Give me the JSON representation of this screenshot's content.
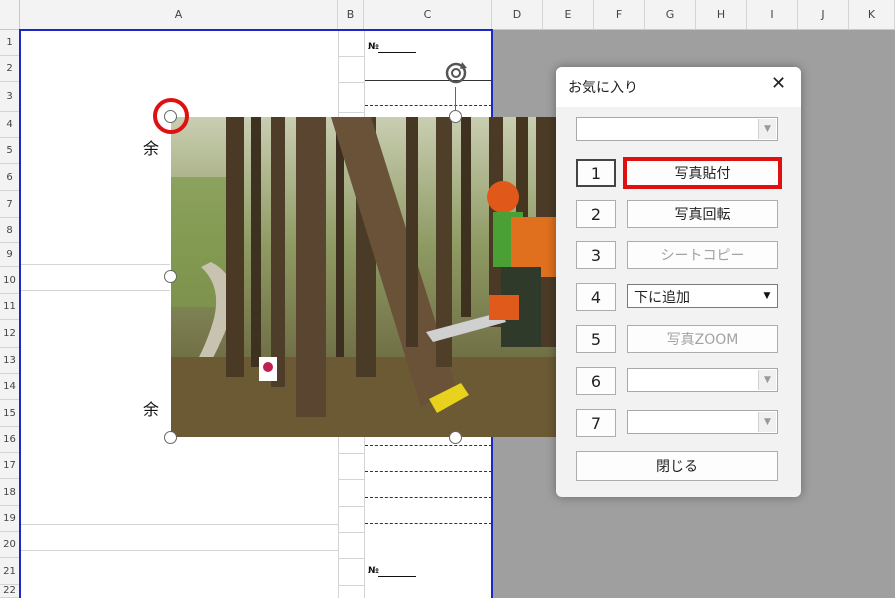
{
  "spreadsheet": {
    "columns": [
      "A",
      "B",
      "C",
      "D",
      "E",
      "F",
      "G",
      "H",
      "I",
      "J",
      "K"
    ],
    "rows": [
      "1",
      "2",
      "3",
      "4",
      "5",
      "6",
      "7",
      "8",
      "9",
      "10",
      "11",
      "12",
      "13",
      "14",
      "15",
      "16",
      "17",
      "18",
      "19",
      "20",
      "21",
      "22"
    ],
    "cell_mark_top": "№",
    "cell_mark_bottom": "№",
    "cell_text_1": "余",
    "cell_text_2": "余"
  },
  "dialog": {
    "title": "お気に入り",
    "close_glyph": "✕",
    "combo_top_value": "",
    "buttons": {
      "num1": "1",
      "num2": "2",
      "num3": "3",
      "num4": "4",
      "num5": "5",
      "num6": "6",
      "num7": "7",
      "paste_photo": "写真貼付",
      "rotate_photo": "写真回転",
      "sheet_copy": "シートコピー",
      "add_below": "下に追加",
      "photo_zoom": "写真ZOOM",
      "close": "閉じる"
    },
    "combo6_value": "",
    "combo7_value": ""
  },
  "photo": {
    "description_icon": "forest-chainsaw-photo"
  },
  "colors": {
    "highlight_red": "#e01010",
    "selection_blue": "#1a27c9",
    "gray_area": "#9f9f9f"
  }
}
